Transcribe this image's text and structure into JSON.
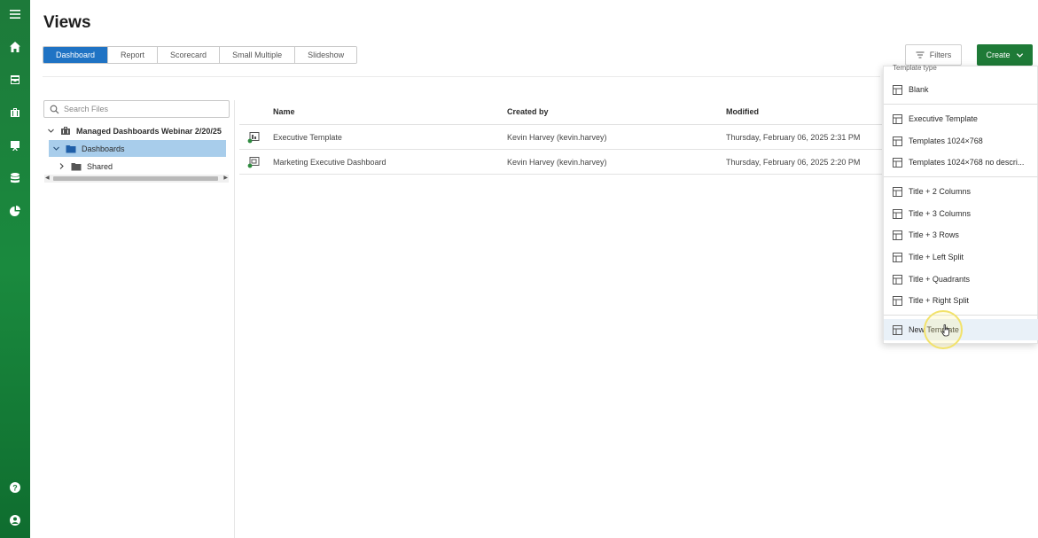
{
  "page": {
    "title": "Views"
  },
  "tabs": [
    {
      "label": "Dashboard",
      "active": true
    },
    {
      "label": "Report",
      "active": false
    },
    {
      "label": "Scorecard",
      "active": false
    },
    {
      "label": "Small Multiple",
      "active": false
    },
    {
      "label": "Slideshow",
      "active": false
    }
  ],
  "toolbar": {
    "filters_label": "Filters",
    "create_label": "Create"
  },
  "search": {
    "placeholder": "Search Files"
  },
  "tree": {
    "root": "Managed Dashboards Webinar 2/20/25",
    "selected": "Dashboards",
    "child": "Shared"
  },
  "table": {
    "columns": {
      "name": "Name",
      "created_by": "Created by",
      "modified": "Modified"
    },
    "rows": [
      {
        "name": "Executive Template",
        "created_by": "Kevin Harvey (kevin.harvey)",
        "modified": "Thursday, February 06, 2025 2:31 PM"
      },
      {
        "name": "Marketing Executive Dashboard",
        "created_by": "Kevin Harvey (kevin.harvey)",
        "modified": "Thursday, February 06, 2025 2:20 PM"
      }
    ]
  },
  "menu": {
    "header": "Template type",
    "items": [
      "Blank",
      "Executive Template",
      "Templates 1024×768",
      "Templates 1024×768 no descri...",
      "Title + 2 Columns",
      "Title + 3 Columns",
      "Title + 3 Rows",
      "Title + Left Split",
      "Title + Quadrants",
      "Title + Right Split",
      "New Template"
    ]
  },
  "colors": {
    "rail": "#1d7a3a",
    "active_tab": "#1f73c4",
    "create": "#1e7a37",
    "tree_selected": "#a8cdeb"
  }
}
